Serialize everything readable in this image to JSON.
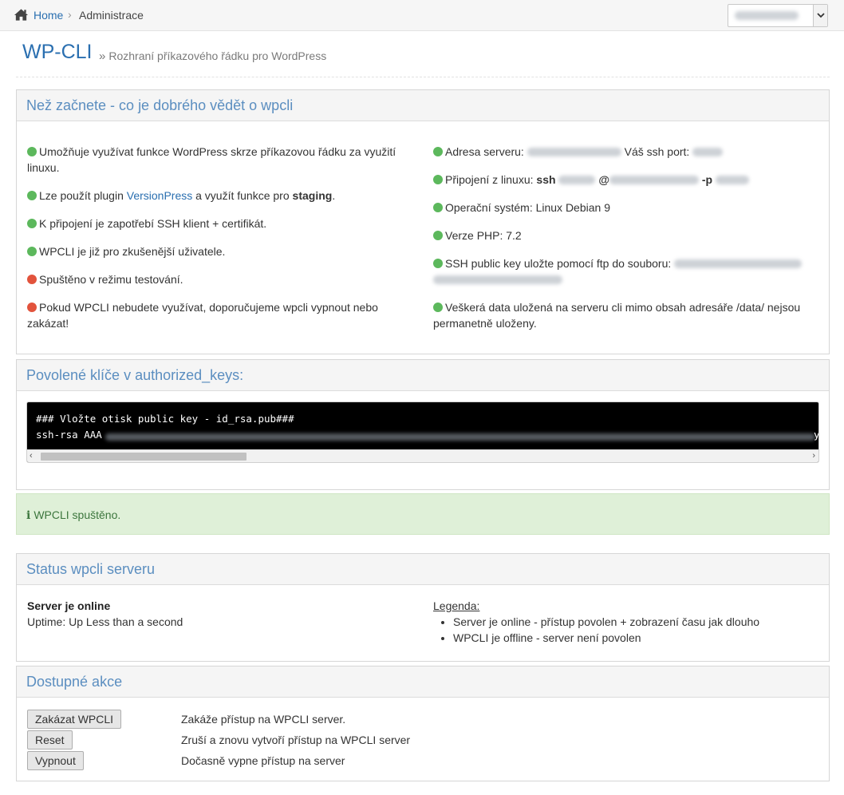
{
  "breadcrumb": {
    "home": "Home",
    "separator": "›",
    "current": "Administrace"
  },
  "domain_select": {
    "value_blurred": true
  },
  "page": {
    "title": "WP-CLI",
    "subtitle_prefix": "»",
    "subtitle": "Rozhraní příkazového řádku pro WordPress"
  },
  "info_panel": {
    "title": "Než začnete - co je dobrého vědět o wpcli",
    "left": [
      {
        "status": "green",
        "text": "Umožňuje využívat funkce WordPress skrze příkazovou řádku za využití linuxu."
      },
      {
        "status": "green",
        "pre": "Lze použít plugin ",
        "link": "VersionPress",
        "mid": " a využít funkce pro ",
        "bold": "staging",
        "post": "."
      },
      {
        "status": "green",
        "text": "K připojení je zapotřebí SSH klient + certifikát."
      },
      {
        "status": "green",
        "text": "WPCLI je již pro zkušenější uživatele."
      },
      {
        "status": "red",
        "text": "Spuštěno v režimu testování."
      },
      {
        "status": "red",
        "text": "Pokud WPCLI nebudete využívat, doporučujeme wpcli vypnout nebo zakázat!"
      }
    ],
    "right": {
      "server_label": "Adresa serveru:",
      "ssh_port_label": "Váš ssh port:",
      "linux_label": "Připojení z linuxu:",
      "linux_ssh": "ssh",
      "linux_at": "@",
      "linux_p": "-p",
      "os": "Operační systém: Linux Debian 9",
      "php": "Verze PHP: 7.2",
      "pubkey_label": "SSH public key uložte pomocí ftp do souboru:",
      "data_note": "Veškerá data uložená na serveru cli mimo obsah adresáře /data/ nejsou permanetně uloženy."
    }
  },
  "keys_panel": {
    "title": "Povolené klíče v authorized_keys:",
    "line1": "### Vložte otisk public key - id_rsa.pub###",
    "line2_prefix": "ssh-rsa AAA",
    "line2_tail": "y",
    "scroll_left": "‹",
    "scroll_right": "›"
  },
  "alert": {
    "icon": "i",
    "text": "WPCLI spuštěno."
  },
  "status_panel": {
    "title": "Status wpcli serveru",
    "state": "Server je online",
    "uptime": "Uptime: Up Less than a second",
    "legend_title": "Legenda:",
    "legend": [
      "Server je online - přístup povolen + zobrazení času jak dlouho",
      "WPCLI je offline - server není povolen"
    ]
  },
  "actions_panel": {
    "title": "Dostupné akce",
    "actions": [
      {
        "label": "Zakázat WPCLI",
        "desc": "Zakáže přístup na WPCLI server."
      },
      {
        "label": "Reset",
        "desc": "Zruší a znovu vytvoří přístup na WPCLI server"
      },
      {
        "label": "Vypnout",
        "desc": "Dočasně vypne přístup na server"
      }
    ]
  },
  "colors": {
    "accent": "#2a6fb0",
    "panel_title": "#5b8ec0",
    "ok": "#5cb85c",
    "warn": "#e2533c",
    "alert_bg": "#dff0d8"
  },
  "icons": {
    "home": "home-icon",
    "select": "chevron-down-icon"
  }
}
